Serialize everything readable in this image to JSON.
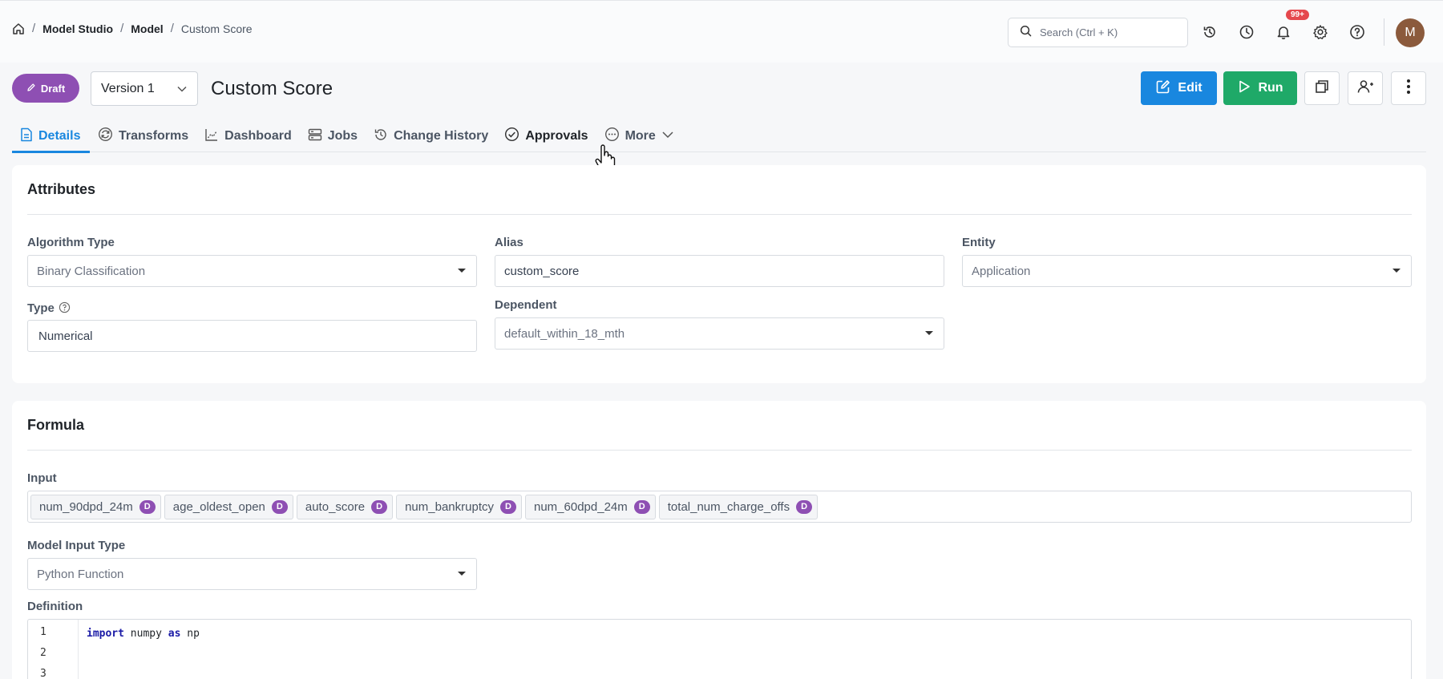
{
  "breadcrumb": {
    "items": [
      "Model Studio",
      "Model"
    ],
    "current": "Custom Score"
  },
  "topbar": {
    "search_placeholder": "Search (Ctrl + K)",
    "notification_badge": "99+",
    "avatar_initial": "M"
  },
  "header": {
    "status": "Draft",
    "version": "Version 1",
    "title": "Custom Score",
    "edit_label": "Edit",
    "run_label": "Run"
  },
  "tabs": [
    {
      "label": "Details",
      "icon": "document-icon"
    },
    {
      "label": "Transforms",
      "icon": "transform-icon"
    },
    {
      "label": "Dashboard",
      "icon": "chart-icon"
    },
    {
      "label": "Jobs",
      "icon": "server-icon"
    },
    {
      "label": "Change History",
      "icon": "history-icon"
    },
    {
      "label": "Approvals",
      "icon": "check-circle-icon"
    },
    {
      "label": "More",
      "icon": "ellipsis-circle-icon"
    }
  ],
  "attributes": {
    "title": "Attributes",
    "algorithm_type_label": "Algorithm Type",
    "algorithm_type_value": "Binary Classification",
    "alias_label": "Alias",
    "alias_value": "custom_score",
    "entity_label": "Entity",
    "entity_value": "Application",
    "type_label": "Type",
    "type_value": "Numerical",
    "dependent_label": "Dependent",
    "dependent_value": "default_within_18_mth"
  },
  "formula": {
    "title": "Formula",
    "input_label": "Input",
    "inputs": [
      {
        "name": "num_90dpd_24m",
        "badge": "D"
      },
      {
        "name": "age_oldest_open",
        "badge": "D"
      },
      {
        "name": "auto_score",
        "badge": "D"
      },
      {
        "name": "num_bankruptcy",
        "badge": "D"
      },
      {
        "name": "num_60dpd_24m",
        "badge": "D"
      },
      {
        "name": "total_num_charge_offs",
        "badge": "D"
      }
    ],
    "model_input_type_label": "Model Input Type",
    "model_input_type_value": "Python Function",
    "definition_label": "Definition",
    "code": {
      "line_numbers": [
        "1",
        "2",
        "3"
      ],
      "kw_import": "import",
      "module": "numpy",
      "kw_as": "as",
      "alias": "np"
    }
  },
  "colors": {
    "primary": "#1987df",
    "run": "#1fa968",
    "draft": "#8e4fb3",
    "notification": "#e5484d"
  }
}
